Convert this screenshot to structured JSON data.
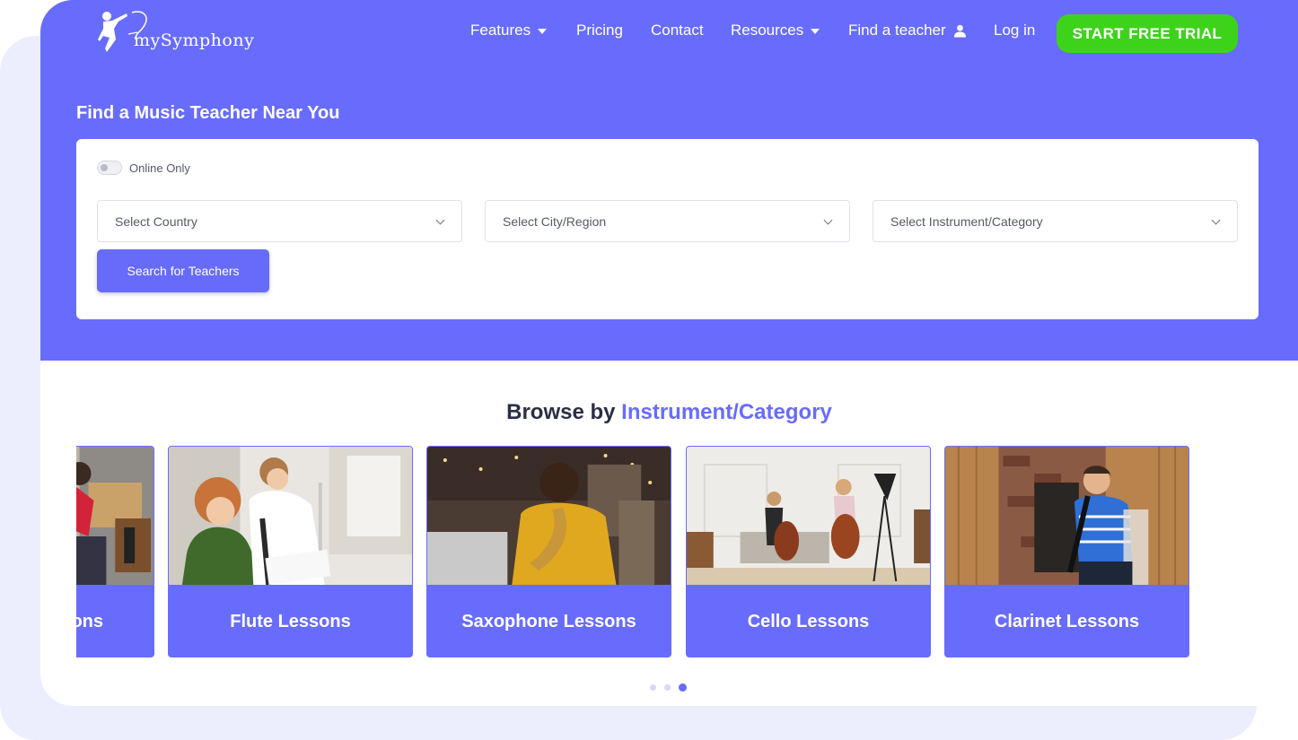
{
  "nav": {
    "logo_text": "mySymphony",
    "items": [
      {
        "label": "Features",
        "dropdown": true
      },
      {
        "label": "Pricing",
        "dropdown": false
      },
      {
        "label": "Contact",
        "dropdown": false
      },
      {
        "label": "Resources",
        "dropdown": true
      },
      {
        "label": "Find a teacher",
        "icon": "user-icon"
      },
      {
        "label": "Log in",
        "dropdown": false
      }
    ],
    "cta": "START FREE TRIAL"
  },
  "hero": {
    "title": "Find a Music Teacher Near You",
    "online_only_label": "Online Only",
    "online_only_checked": false,
    "country_placeholder": "Select Country",
    "city_placeholder": "Select City/Region",
    "instrument_placeholder": "Select Instrument/Category",
    "search_button": "Search for Teachers"
  },
  "browse": {
    "title_prefix": "Browse by",
    "title_accent": "Instrument/Category",
    "cards": [
      {
        "label": "ons"
      },
      {
        "label": "Flute Lessons"
      },
      {
        "label": "Saxophone Lessons"
      },
      {
        "label": "Cello Lessons"
      },
      {
        "label": "Clarinet Lessons"
      }
    ],
    "carousel_pages": 3,
    "carousel_active": 3
  },
  "colors": {
    "brand": "#686cfc",
    "cta": "#3ed31b",
    "heading": "#2a2f45"
  }
}
